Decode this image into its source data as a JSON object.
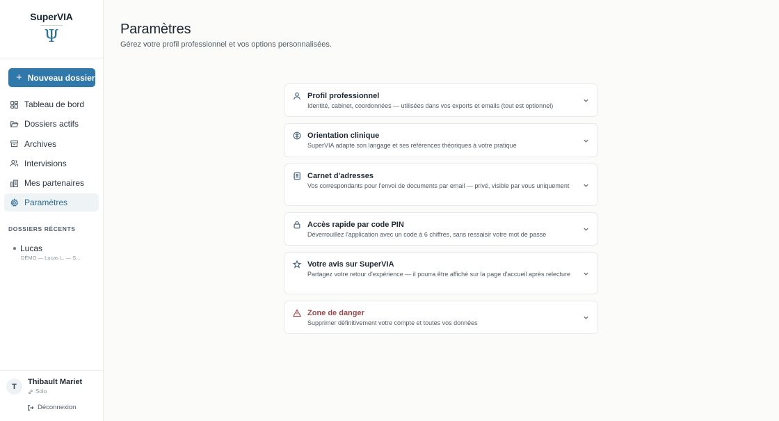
{
  "brand": {
    "name": "SuperVIA",
    "symbol": "Ψ"
  },
  "sidebar": {
    "new_button": {
      "icon": "plus-icon",
      "label": "Nouveau dossier"
    },
    "items": [
      {
        "label": "Tableau de bord",
        "icon": "dashboard-icon",
        "active": false
      },
      {
        "label": "Dossiers actifs",
        "icon": "folder-open-icon",
        "active": false
      },
      {
        "label": "Archives",
        "icon": "archive-icon",
        "active": false
      },
      {
        "label": "Intervisions",
        "icon": "users-icon",
        "active": false
      },
      {
        "label": "Mes partenaires",
        "icon": "buildings-icon",
        "active": false
      },
      {
        "label": "Paramètres",
        "icon": "gear-icon",
        "active": true
      }
    ],
    "recent_title": "DOSSIERS RÉCENTS",
    "recent": [
      {
        "name": "Lucas",
        "subtitle": "DÉMO — Lucas L. — S..."
      }
    ],
    "user": {
      "initial": "T",
      "name": "Thibault Mariet",
      "plan": "Solo",
      "logout_label": "Déconnexion"
    }
  },
  "main": {
    "title": "Paramètres",
    "subtitle": "Gérez votre profil professionnel et vos options personnalisées.",
    "sections": [
      {
        "title": "Profil professionnel",
        "description": "Identité, cabinet, coordonnées — utilisées dans vos exports et emails (tout est optionnel)",
        "icon": "user-icon"
      },
      {
        "title": "Orientation clinique",
        "description": "SuperVIA adapte son langage et ses références théoriques à votre pratique",
        "icon": "compass-icon"
      },
      {
        "title": "Carnet d'adresses",
        "description": "Vos correspondants pour l'envoi de documents par email — privé, visible par vous uniquement",
        "icon": "address-book-icon"
      },
      {
        "title": "Accès rapide par code PIN",
        "description": "Déverrouillez l'application avec un code à 6 chiffres, sans ressaisir votre mot de passe",
        "icon": "lock-icon"
      },
      {
        "title": "Votre avis sur SuperVIA",
        "description": "Partagez votre retour d'expérience — il pourra être affiché sur la page d'accueil après relecture",
        "icon": "star-icon"
      },
      {
        "title": "Zone de danger",
        "description": "Supprimer définitivement votre compte et toutes vos données",
        "icon": "warning-icon"
      }
    ]
  },
  "colors": {
    "accent": "#2f78a9",
    "active_nav_bg": "#eef3f6",
    "danger": "#9a4a4a"
  }
}
